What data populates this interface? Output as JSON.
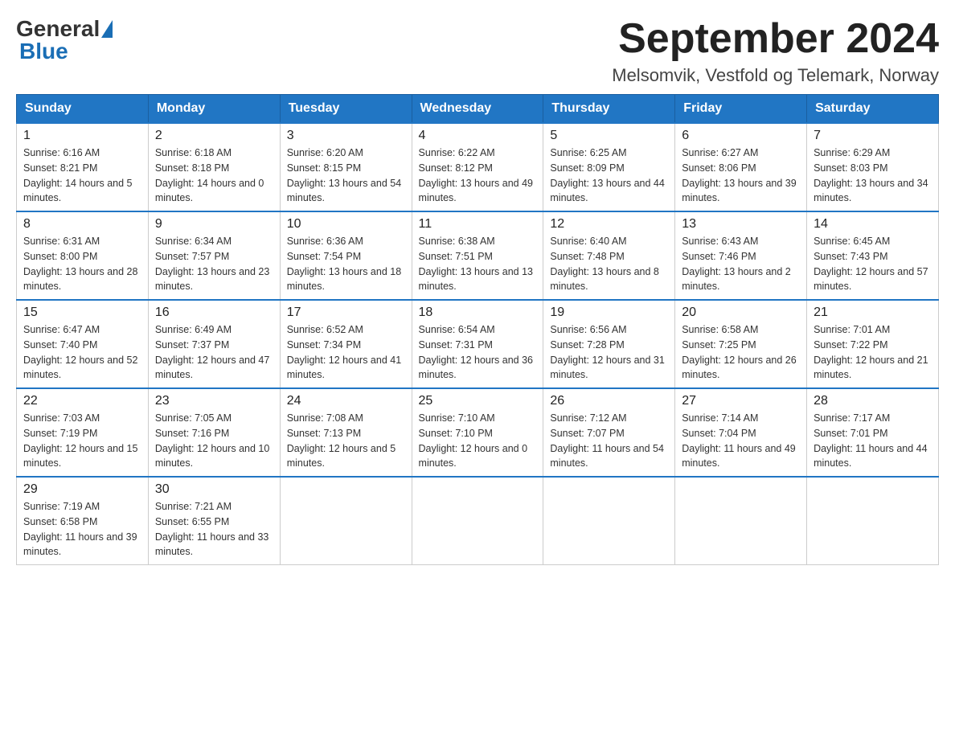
{
  "logo": {
    "general": "General",
    "blue": "Blue"
  },
  "header": {
    "month": "September 2024",
    "location": "Melsomvik, Vestfold og Telemark, Norway"
  },
  "weekdays": [
    "Sunday",
    "Monday",
    "Tuesday",
    "Wednesday",
    "Thursday",
    "Friday",
    "Saturday"
  ],
  "weeks": [
    [
      {
        "day": "1",
        "sunrise": "6:16 AM",
        "sunset": "8:21 PM",
        "daylight": "14 hours and 5 minutes."
      },
      {
        "day": "2",
        "sunrise": "6:18 AM",
        "sunset": "8:18 PM",
        "daylight": "14 hours and 0 minutes."
      },
      {
        "day": "3",
        "sunrise": "6:20 AM",
        "sunset": "8:15 PM",
        "daylight": "13 hours and 54 minutes."
      },
      {
        "day": "4",
        "sunrise": "6:22 AM",
        "sunset": "8:12 PM",
        "daylight": "13 hours and 49 minutes."
      },
      {
        "day": "5",
        "sunrise": "6:25 AM",
        "sunset": "8:09 PM",
        "daylight": "13 hours and 44 minutes."
      },
      {
        "day": "6",
        "sunrise": "6:27 AM",
        "sunset": "8:06 PM",
        "daylight": "13 hours and 39 minutes."
      },
      {
        "day": "7",
        "sunrise": "6:29 AM",
        "sunset": "8:03 PM",
        "daylight": "13 hours and 34 minutes."
      }
    ],
    [
      {
        "day": "8",
        "sunrise": "6:31 AM",
        "sunset": "8:00 PM",
        "daylight": "13 hours and 28 minutes."
      },
      {
        "day": "9",
        "sunrise": "6:34 AM",
        "sunset": "7:57 PM",
        "daylight": "13 hours and 23 minutes."
      },
      {
        "day": "10",
        "sunrise": "6:36 AM",
        "sunset": "7:54 PM",
        "daylight": "13 hours and 18 minutes."
      },
      {
        "day": "11",
        "sunrise": "6:38 AM",
        "sunset": "7:51 PM",
        "daylight": "13 hours and 13 minutes."
      },
      {
        "day": "12",
        "sunrise": "6:40 AM",
        "sunset": "7:48 PM",
        "daylight": "13 hours and 8 minutes."
      },
      {
        "day": "13",
        "sunrise": "6:43 AM",
        "sunset": "7:46 PM",
        "daylight": "13 hours and 2 minutes."
      },
      {
        "day": "14",
        "sunrise": "6:45 AM",
        "sunset": "7:43 PM",
        "daylight": "12 hours and 57 minutes."
      }
    ],
    [
      {
        "day": "15",
        "sunrise": "6:47 AM",
        "sunset": "7:40 PM",
        "daylight": "12 hours and 52 minutes."
      },
      {
        "day": "16",
        "sunrise": "6:49 AM",
        "sunset": "7:37 PM",
        "daylight": "12 hours and 47 minutes."
      },
      {
        "day": "17",
        "sunrise": "6:52 AM",
        "sunset": "7:34 PM",
        "daylight": "12 hours and 41 minutes."
      },
      {
        "day": "18",
        "sunrise": "6:54 AM",
        "sunset": "7:31 PM",
        "daylight": "12 hours and 36 minutes."
      },
      {
        "day": "19",
        "sunrise": "6:56 AM",
        "sunset": "7:28 PM",
        "daylight": "12 hours and 31 minutes."
      },
      {
        "day": "20",
        "sunrise": "6:58 AM",
        "sunset": "7:25 PM",
        "daylight": "12 hours and 26 minutes."
      },
      {
        "day": "21",
        "sunrise": "7:01 AM",
        "sunset": "7:22 PM",
        "daylight": "12 hours and 21 minutes."
      }
    ],
    [
      {
        "day": "22",
        "sunrise": "7:03 AM",
        "sunset": "7:19 PM",
        "daylight": "12 hours and 15 minutes."
      },
      {
        "day": "23",
        "sunrise": "7:05 AM",
        "sunset": "7:16 PM",
        "daylight": "12 hours and 10 minutes."
      },
      {
        "day": "24",
        "sunrise": "7:08 AM",
        "sunset": "7:13 PM",
        "daylight": "12 hours and 5 minutes."
      },
      {
        "day": "25",
        "sunrise": "7:10 AM",
        "sunset": "7:10 PM",
        "daylight": "12 hours and 0 minutes."
      },
      {
        "day": "26",
        "sunrise": "7:12 AM",
        "sunset": "7:07 PM",
        "daylight": "11 hours and 54 minutes."
      },
      {
        "day": "27",
        "sunrise": "7:14 AM",
        "sunset": "7:04 PM",
        "daylight": "11 hours and 49 minutes."
      },
      {
        "day": "28",
        "sunrise": "7:17 AM",
        "sunset": "7:01 PM",
        "daylight": "11 hours and 44 minutes."
      }
    ],
    [
      {
        "day": "29",
        "sunrise": "7:19 AM",
        "sunset": "6:58 PM",
        "daylight": "11 hours and 39 minutes."
      },
      {
        "day": "30",
        "sunrise": "7:21 AM",
        "sunset": "6:55 PM",
        "daylight": "11 hours and 33 minutes."
      },
      null,
      null,
      null,
      null,
      null
    ]
  ],
  "labels": {
    "sunrise": "Sunrise:",
    "sunset": "Sunset:",
    "daylight": "Daylight:"
  }
}
